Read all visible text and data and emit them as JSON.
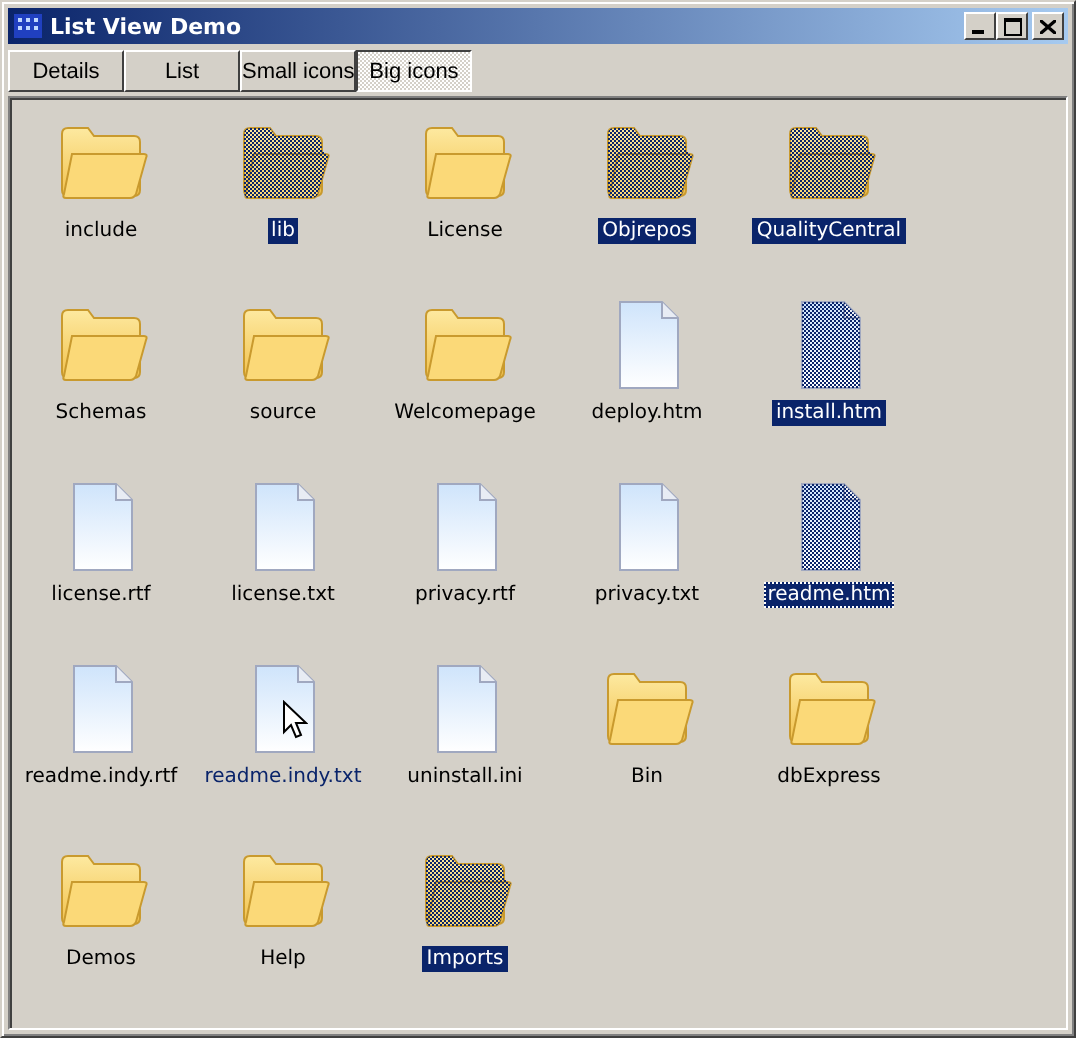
{
  "window": {
    "title": "List View Demo"
  },
  "tabs": [
    {
      "label": "Details",
      "selected": false
    },
    {
      "label": "List",
      "selected": false
    },
    {
      "label": "Small icons",
      "selected": false
    },
    {
      "label": "Big icons",
      "selected": true
    }
  ],
  "items": [
    {
      "label": "include",
      "kind": "folder",
      "selected": false,
      "hot": false,
      "focused": false
    },
    {
      "label": "lib",
      "kind": "folder",
      "selected": true,
      "hot": false,
      "focused": false
    },
    {
      "label": "License",
      "kind": "folder",
      "selected": false,
      "hot": false,
      "focused": false
    },
    {
      "label": "Objrepos",
      "kind": "folder",
      "selected": true,
      "hot": false,
      "focused": false
    },
    {
      "label": "QualityCentral",
      "kind": "folder",
      "selected": true,
      "hot": false,
      "focused": false
    },
    {
      "label": "Schemas",
      "kind": "folder",
      "selected": false,
      "hot": false,
      "focused": false
    },
    {
      "label": "source",
      "kind": "folder",
      "selected": false,
      "hot": false,
      "focused": false
    },
    {
      "label": "Welcomepage",
      "kind": "folder",
      "selected": false,
      "hot": false,
      "focused": false
    },
    {
      "label": "deploy.htm",
      "kind": "file",
      "selected": false,
      "hot": false,
      "focused": false
    },
    {
      "label": "install.htm",
      "kind": "file",
      "selected": true,
      "hot": false,
      "focused": false
    },
    {
      "label": "license.rtf",
      "kind": "file",
      "selected": false,
      "hot": false,
      "focused": false
    },
    {
      "label": "license.txt",
      "kind": "file",
      "selected": false,
      "hot": false,
      "focused": false
    },
    {
      "label": "privacy.rtf",
      "kind": "file",
      "selected": false,
      "hot": false,
      "focused": false
    },
    {
      "label": "privacy.txt",
      "kind": "file",
      "selected": false,
      "hot": false,
      "focused": false
    },
    {
      "label": "readme.htm",
      "kind": "file",
      "selected": true,
      "hot": false,
      "focused": true
    },
    {
      "label": "readme.indy.rtf",
      "kind": "file",
      "selected": false,
      "hot": false,
      "focused": false
    },
    {
      "label": "readme.indy.txt",
      "kind": "file",
      "selected": false,
      "hot": true,
      "focused": false
    },
    {
      "label": "uninstall.ini",
      "kind": "file",
      "selected": false,
      "hot": false,
      "focused": false
    },
    {
      "label": "Bin",
      "kind": "folder",
      "selected": false,
      "hot": false,
      "focused": false
    },
    {
      "label": "dbExpress",
      "kind": "folder",
      "selected": false,
      "hot": false,
      "focused": false
    },
    {
      "label": "Demos",
      "kind": "folder",
      "selected": false,
      "hot": false,
      "focused": false
    },
    {
      "label": "Help",
      "kind": "folder",
      "selected": false,
      "hot": false,
      "focused": false
    },
    {
      "label": "Imports",
      "kind": "folder",
      "selected": true,
      "hot": false,
      "focused": false
    }
  ]
}
